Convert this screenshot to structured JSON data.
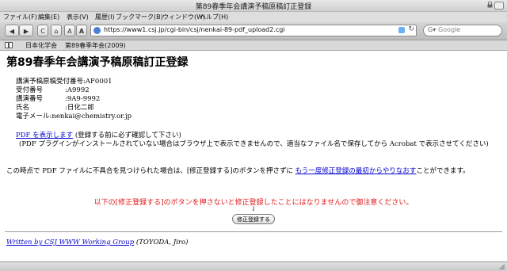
{
  "window": {
    "title": "第89春季年会講演予稿原稿訂正登録"
  },
  "menu": [
    "ファイル(F)",
    "編集(E)",
    "表示(V)",
    "履歴(I)",
    "ブックマーク(B)",
    "ウィンドウ(W)",
    "ヘルプ(H)"
  ],
  "toolbar": {
    "back": "◀",
    "forward": "▶",
    "reload": "C",
    "home": "⌂",
    "text_smaller": "A",
    "text_larger": "A",
    "url": "https://www1.csj.jp/cgi-bin/csj/nenkai-89-pdf_upload2.cgi",
    "search_placeholder": "Google"
  },
  "bookmarks": [
    "日本化学会",
    "第89春季年会(2009)"
  ],
  "page": {
    "heading": "第89春季年会講演予稿原稿訂正登録",
    "info": [
      {
        "label": "講演予稿原稿受付番号",
        "value": ":AF0001"
      },
      {
        "label": "受付番号",
        "value": ":A9992"
      },
      {
        "label": "講演番号",
        "value": ":9A9-9992"
      },
      {
        "label": "氏名",
        "value": ":日化二郎"
      },
      {
        "label": "電子メール",
        "value": ":nenkai@chemistry.or.jp"
      }
    ],
    "pdf_link": "PDF を表示します",
    "pdf_note": "(登録する前に必ず確認して下さい)",
    "plugin_note": "(PDF プラグインがインストールされていない場合はブラウザ上で表示できませんので、適当なファイル名で保存してから Acrobat で表示させてください)",
    "err_before": "この時点で PDF ファイルに不具合を見つけられた場合は、[修正登録する]のボタンを押さずに",
    "err_link": "もう一度修正登録の最初からやりなおす",
    "err_after": "ことができます。",
    "warning": "以下の[修正登録する]のボタンを押さないと修正登録したことにはなりませんので御注意ください。",
    "arrow": "↓",
    "submit_label": "修正登録する",
    "footer_link": "Written by CSJ WWW Working Group",
    "footer_text": " (TOYODA, Jiro)"
  }
}
